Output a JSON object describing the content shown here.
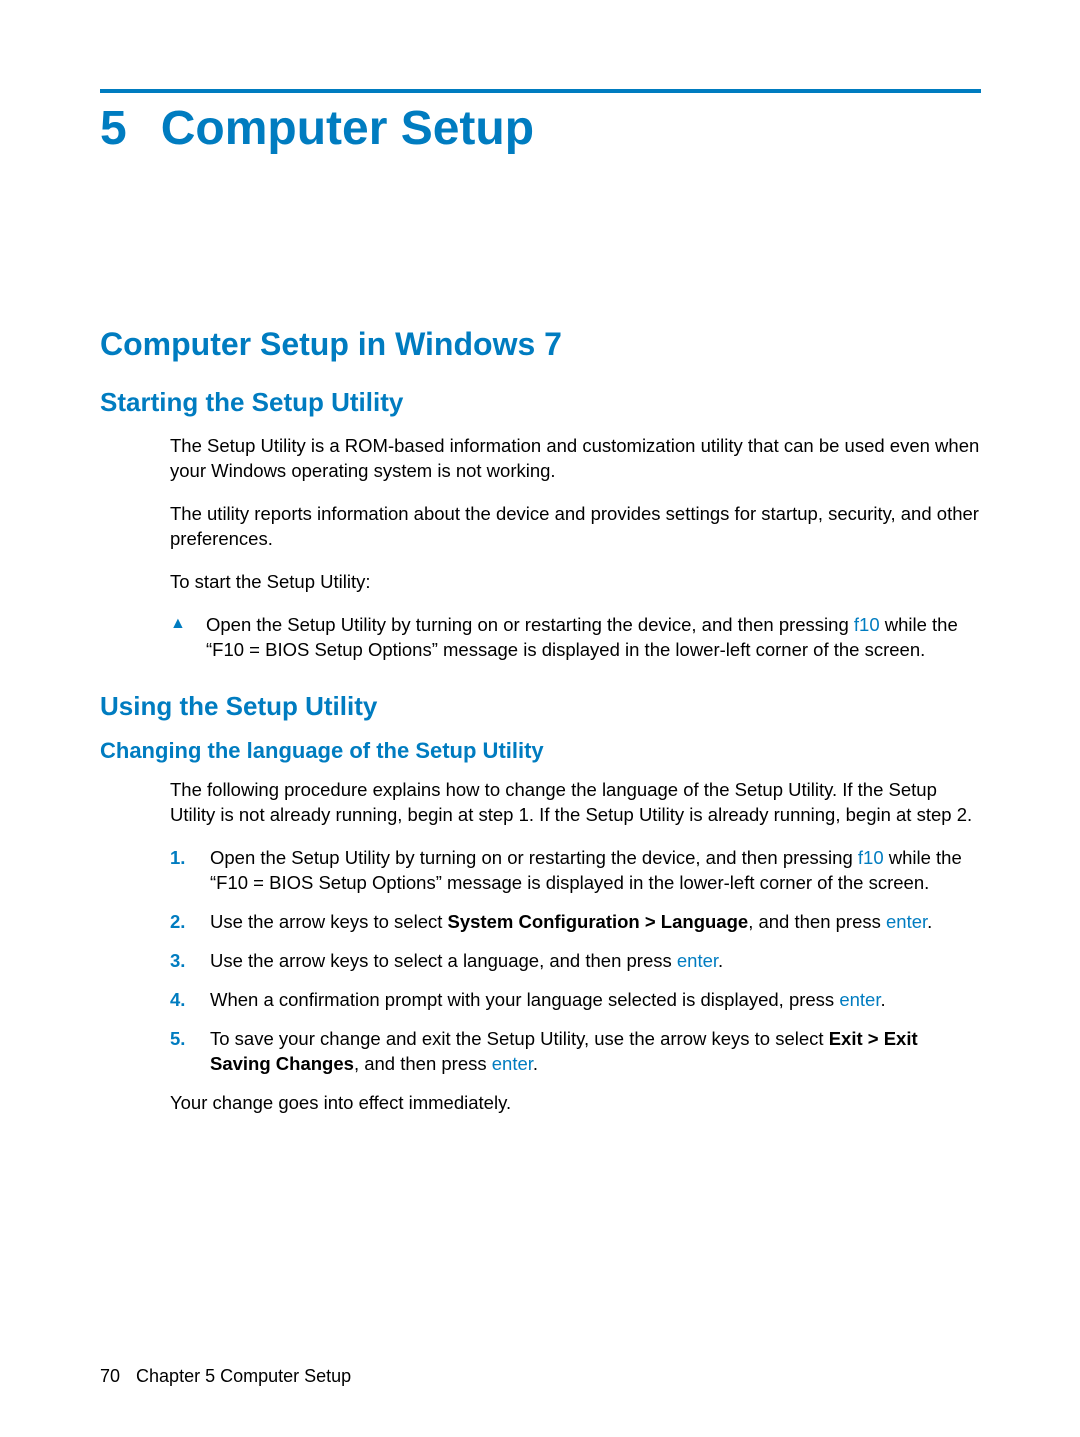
{
  "chapter": {
    "number": "5",
    "title": "Computer Setup"
  },
  "h1": "Computer Setup in Windows 7",
  "section1": {
    "heading": "Starting the Setup Utility",
    "p1": "The Setup Utility is a ROM-based information and customization utility that can be used even when your Windows operating system is not working.",
    "p2": "The utility reports information about the device and provides settings for startup, security, and other preferences.",
    "p3": "To start the Setup Utility:",
    "bullet": {
      "pre": "Open the Setup Utility by turning on or restarting the device, and then pressing ",
      "key": "f10",
      "post": " while the “F10 = BIOS Setup Options” message is displayed in the lower-left corner of the screen."
    }
  },
  "section2": {
    "heading": "Using the Setup Utility",
    "sub1": {
      "heading": "Changing the language of the Setup Utility",
      "p1": "The following procedure explains how to change the language of the Setup Utility. If the Setup Utility is not already running, begin at step 1. If the Setup Utility is already running, begin at step 2.",
      "steps": {
        "s1": {
          "num": "1.",
          "pre": "Open the Setup Utility by turning on or restarting the device, and then pressing ",
          "key": "f10",
          "post": " while the “F10 = BIOS Setup Options” message is displayed in the lower-left corner of the screen."
        },
        "s2": {
          "num": "2.",
          "pre": "Use the arrow keys to select ",
          "bold": "System Configuration > Language",
          "mid": ", and then press ",
          "key": "enter",
          "post": "."
        },
        "s3": {
          "num": "3.",
          "pre": "Use the arrow keys to select a language, and then press ",
          "key": "enter",
          "post": "."
        },
        "s4": {
          "num": "4.",
          "pre": "When a confirmation prompt with your language selected is displayed, press ",
          "key": "enter",
          "post": "."
        },
        "s5": {
          "num": "5.",
          "pre": "To save your change and exit the Setup Utility, use the arrow keys to select ",
          "bold": "Exit > Exit Saving Changes",
          "mid": ", and then press ",
          "key": "enter",
          "post": "."
        }
      },
      "p2": "Your change goes into effect immediately."
    }
  },
  "footer": {
    "pagenum": "70",
    "chapterlabel": "Chapter 5   Computer Setup"
  }
}
